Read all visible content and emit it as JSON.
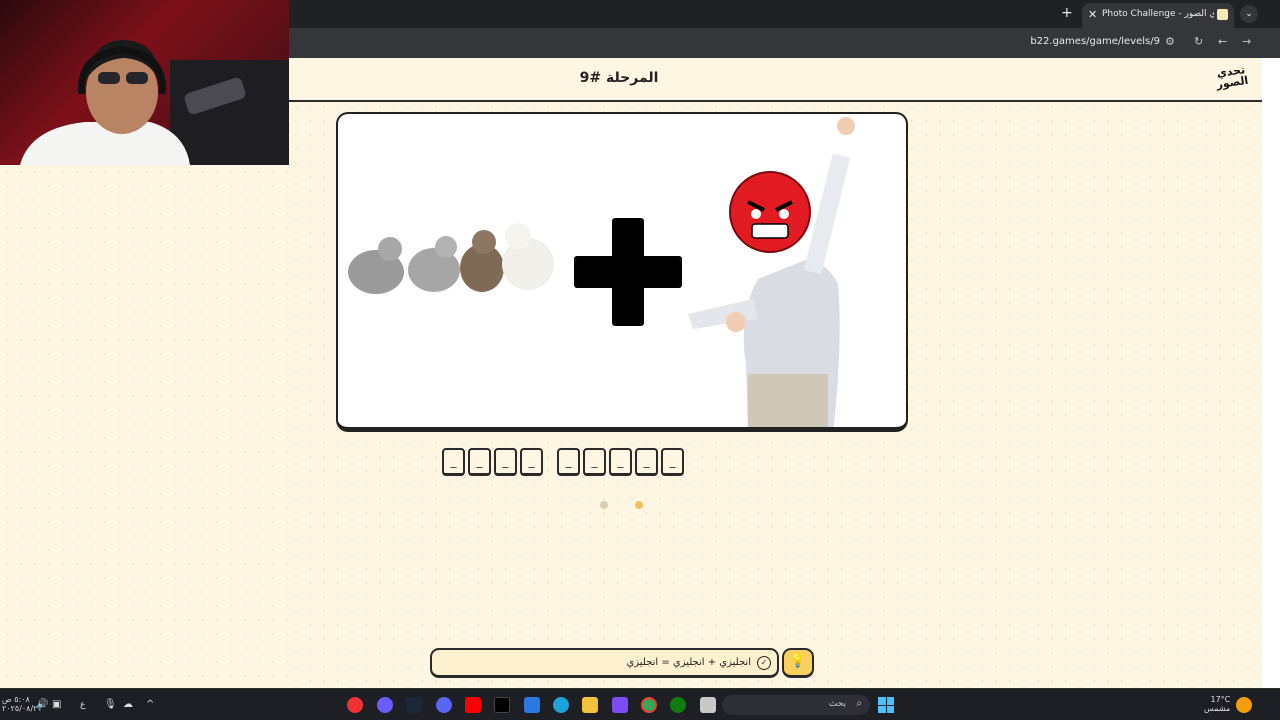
{
  "browser": {
    "tab_title": "Photo Challenge - تحدي الصور",
    "url": "b22.games/game/levels/9",
    "new_tab": "+",
    "tab_close": "✕"
  },
  "game": {
    "level_title": "المرحلة #9",
    "logo_text": "تحدي الصور",
    "word1_slots": [
      "_",
      "_",
      "_",
      "_"
    ],
    "word2_slots": [
      "_",
      "_",
      "_",
      "_",
      "_"
    ],
    "hint": "انجليزي + انجليزي = انجليزي",
    "bulb": "💡",
    "hint_check": "✓"
  },
  "taskbar": {
    "clock_time": "٥:٠٨ ص",
    "clock_date": "٢٠٢٥/٠٨/٢١",
    "lang": "ع",
    "search_label": "بحث",
    "weather_temp": "17°C",
    "weather_desc": "مشمس"
  },
  "colors": {
    "page_bg": "#fdf6e3",
    "accent": "#f9cf5e",
    "dot_active": "#f2c25a",
    "dot_inactive": "#d9cfae"
  }
}
